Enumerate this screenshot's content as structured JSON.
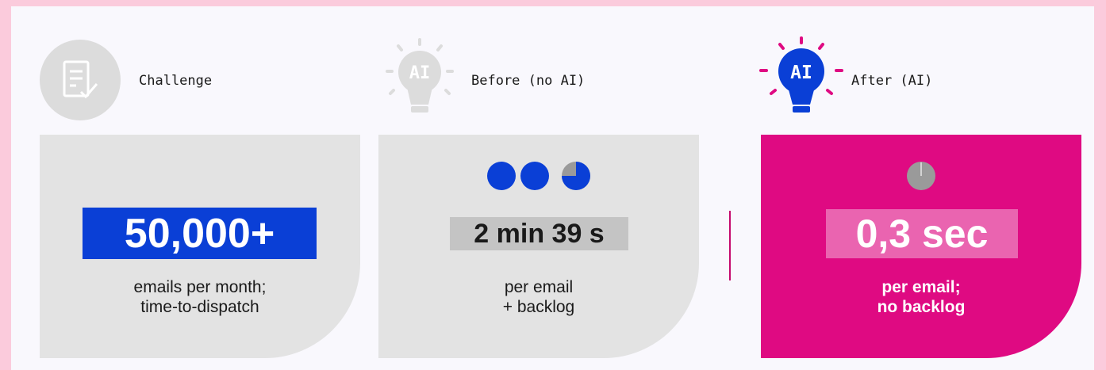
{
  "columns": {
    "challenge": {
      "header": "Challenge",
      "icon": "document-check-icon",
      "value": "50,000+",
      "description": [
        "emails per month;",
        "time-to-dispatch"
      ]
    },
    "before": {
      "header": "Before (no AI)",
      "icon": "ai-lightbulb-icon",
      "icon_text": "AI",
      "value": "2 min 39 s",
      "description": [
        "per email",
        "+ backlog"
      ],
      "progress_circles": [
        1,
        1,
        0.75
      ]
    },
    "after": {
      "header": "After (AI)",
      "icon": "ai-lightbulb-icon",
      "icon_text": "AI",
      "value": "0,3 sec",
      "description": [
        "per email;",
        "no backlog"
      ],
      "progress_circles": [
        0.02
      ]
    }
  },
  "colors": {
    "background": "#fbcbdc",
    "panel": "#f9f8fd",
    "card_gray": "#e3e3e3",
    "card_pink": "#df0a82",
    "blue": "#0a3fd6",
    "icon_gray": "#d9d9d9"
  }
}
